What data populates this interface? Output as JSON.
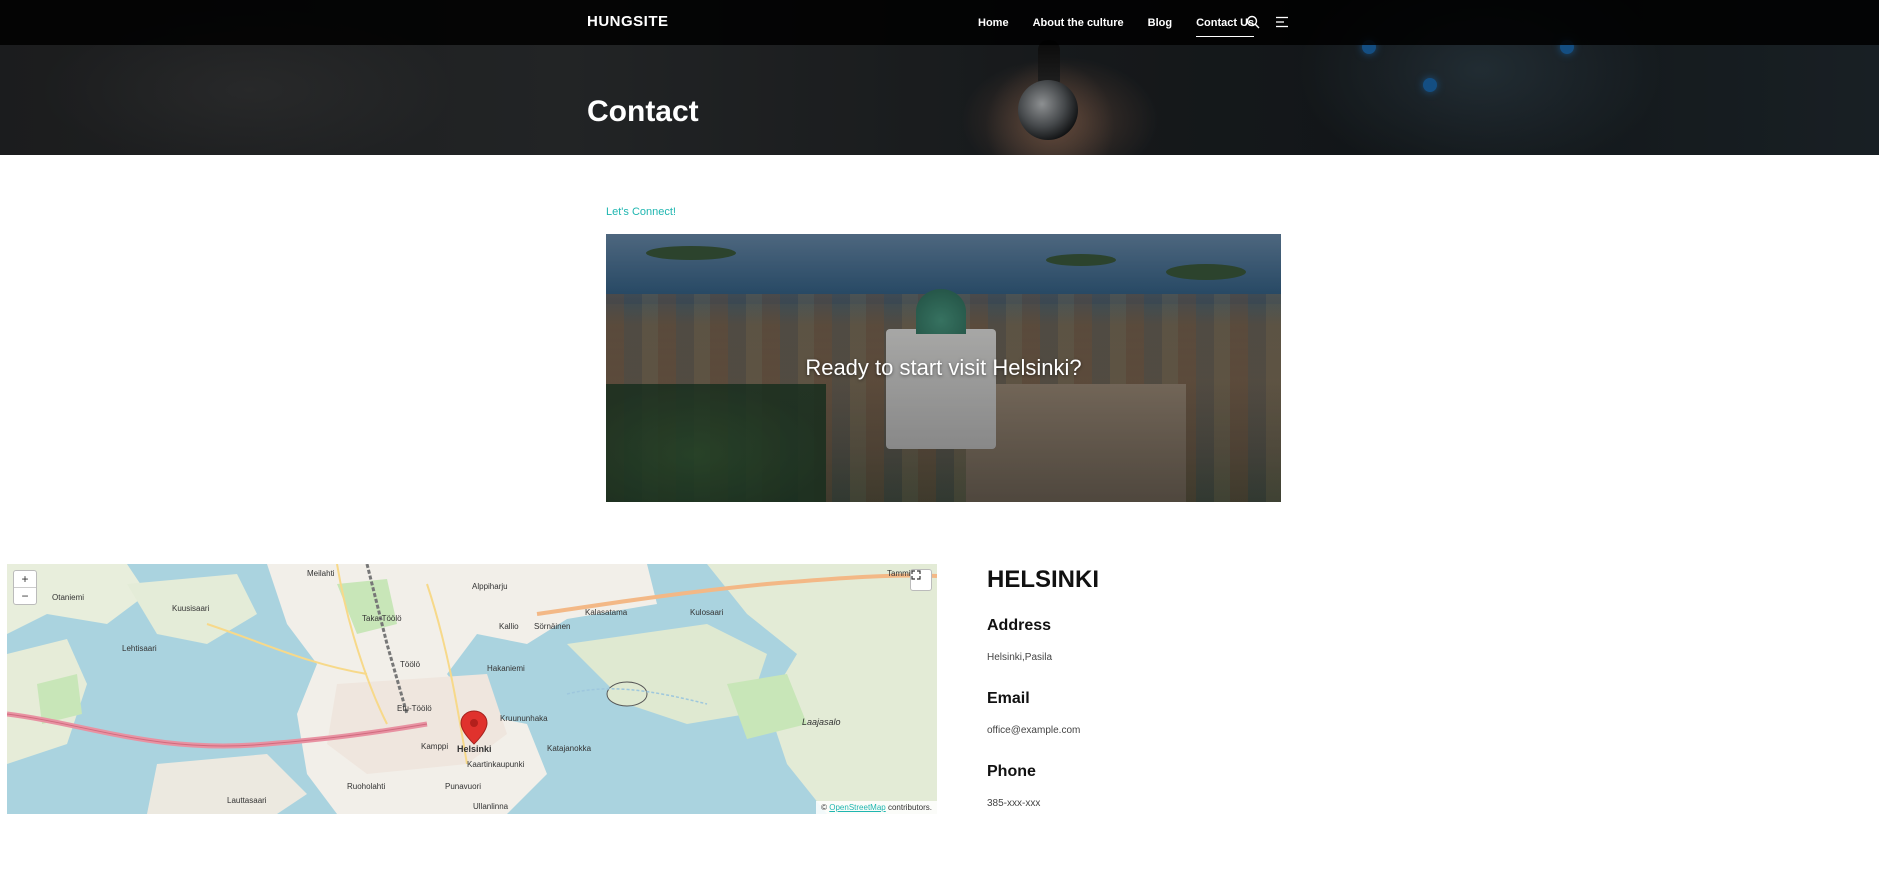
{
  "site": {
    "logo": "HUNGSITE"
  },
  "nav": {
    "items": [
      {
        "label": "Home"
      },
      {
        "label": "About the culture"
      },
      {
        "label": "Blog"
      },
      {
        "label": "Contact Us",
        "active": true
      }
    ],
    "icons": [
      "search-icon",
      "menu-icon"
    ]
  },
  "hero": {
    "title": "Contact"
  },
  "connect": {
    "eyebrow": "Let's Connect!",
    "banner_text": "Ready to start visit Helsinki?"
  },
  "map": {
    "zoom_in": "+",
    "zoom_out": "−",
    "fullscreen_icon": "expand-icon",
    "attribution_prefix": "©",
    "attribution_link": "OpenStreetMap",
    "attribution_suffix": "contributors.",
    "labels": {
      "otaniemi": "Otaniemi",
      "kuusisaari": "Kuusisaari",
      "lehtisaari": "Lehtisaari",
      "meilahti": "Meilahti",
      "taka_toolo": "Taka-Töölö",
      "alppiharju": "Alppiharju",
      "kallio": "Kallio",
      "sornainen": "Sörnäinen",
      "kulosaari": "Kulosaari",
      "kalasatama": "Kalasatama",
      "hakaniemi": "Hakaniemi",
      "toolo": "Töölö",
      "etu_toolo": "Etu-Töölö",
      "kamppi": "Kamppi",
      "helsinki": "Helsinki",
      "kruununhaka": "Kruununhaka",
      "katajanokka": "Katajanokka",
      "kaartinkaupunki": "Kaartinkaupunki",
      "punavuori": "Punavuori",
      "ruoholahti": "Ruoholahti",
      "lauttasaari": "Lauttasaari",
      "ullanlinna": "Ullanlinna",
      "laajasalo": "Laajasalo",
      "tammisalo": "Tammisalo"
    }
  },
  "contact": {
    "city": "HELSINKI",
    "address_label": "Address",
    "address_value": "Helsinki,Pasila",
    "email_label": "Email",
    "email_value": "office@example.com",
    "phone_label": "Phone",
    "phone_value": "385-xxx-xxx"
  },
  "colors": {
    "accent": "#1fb6b0",
    "navbar": "#000000",
    "map_water": "#aad3df",
    "map_land": "#f2efe9",
    "marker": "#e0322d"
  }
}
